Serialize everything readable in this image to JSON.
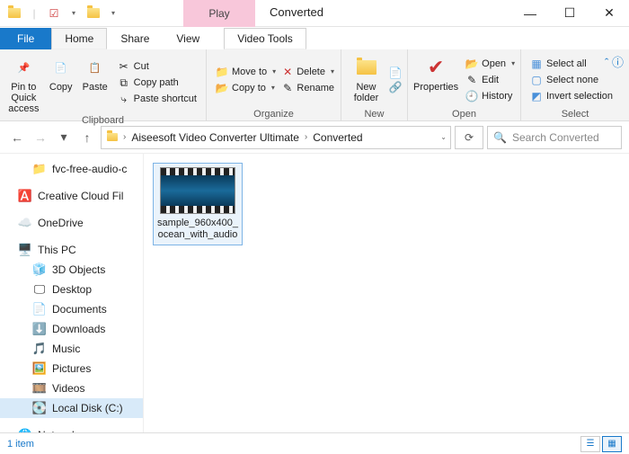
{
  "window": {
    "title": "Converted",
    "contextual_tab_group": "Play",
    "contextual_tab": "Video Tools"
  },
  "tabs": {
    "file": "File",
    "home": "Home",
    "share": "Share",
    "view": "View"
  },
  "ribbon": {
    "clipboard": {
      "label": "Clipboard",
      "pin": "Pin to Quick access",
      "copy": "Copy",
      "paste": "Paste",
      "cut": "Cut",
      "copy_path": "Copy path",
      "paste_shortcut": "Paste shortcut"
    },
    "organize": {
      "label": "Organize",
      "move_to": "Move to",
      "copy_to": "Copy to",
      "delete": "Delete",
      "rename": "Rename"
    },
    "new": {
      "label": "New",
      "new_folder": "New folder"
    },
    "open": {
      "label": "Open",
      "properties": "Properties",
      "open": "Open",
      "edit": "Edit",
      "history": "History"
    },
    "select": {
      "label": "Select",
      "select_all": "Select all",
      "select_none": "Select none",
      "invert": "Invert selection"
    }
  },
  "address": {
    "crumb1": "Aiseesoft Video Converter Ultimate",
    "crumb2": "Converted"
  },
  "search": {
    "placeholder": "Search Converted"
  },
  "tree": {
    "items": [
      {
        "icon": "folder",
        "label": "fvc-free-audio-c",
        "indent": true
      },
      {
        "icon": "cc",
        "label": "Creative Cloud Fil",
        "indent": false
      },
      {
        "icon": "onedrive",
        "label": "OneDrive",
        "indent": false
      },
      {
        "icon": "thispc",
        "label": "This PC",
        "indent": false
      },
      {
        "icon": "3d",
        "label": "3D Objects",
        "indent": true
      },
      {
        "icon": "desktop",
        "label": "Desktop",
        "indent": true
      },
      {
        "icon": "doc",
        "label": "Documents",
        "indent": true
      },
      {
        "icon": "down",
        "label": "Downloads",
        "indent": true
      },
      {
        "icon": "music",
        "label": "Music",
        "indent": true
      },
      {
        "icon": "pic",
        "label": "Pictures",
        "indent": true
      },
      {
        "icon": "video",
        "label": "Videos",
        "indent": true
      },
      {
        "icon": "disk",
        "label": "Local Disk (C:)",
        "indent": true,
        "selected": true
      },
      {
        "icon": "net",
        "label": "Network",
        "indent": false
      }
    ]
  },
  "files": [
    {
      "name": "sample_960x400_ocean_with_audio"
    }
  ],
  "status": {
    "count": "1 item"
  }
}
